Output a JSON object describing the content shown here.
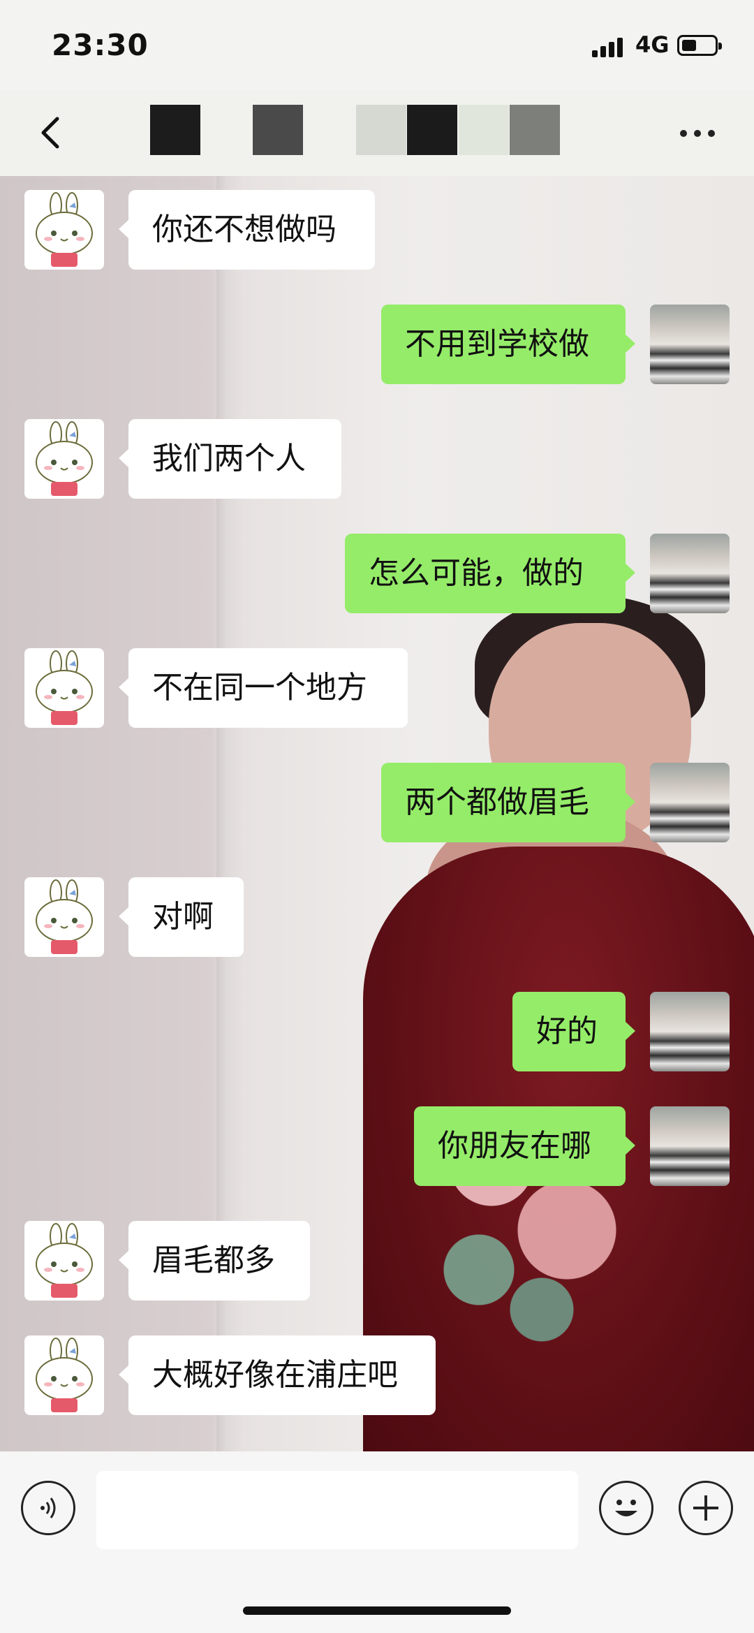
{
  "status_bar": {
    "time": "23:30",
    "network": "4G",
    "icons": [
      "signal-icon",
      "battery-icon"
    ]
  },
  "nav": {
    "back_icon": "chevron-left-icon",
    "more_icon": "more-icon"
  },
  "colors": {
    "outgoing_bubble": "#95ec69",
    "incoming_bubble": "#ffffff"
  },
  "messages": [
    {
      "side": "in",
      "text": "你还不想做吗"
    },
    {
      "side": "out",
      "text": "不用到学校做"
    },
    {
      "side": "in",
      "text": "我们两个人"
    },
    {
      "side": "out",
      "text": "怎么可能，做的"
    },
    {
      "side": "in",
      "text": "不在同一个地方"
    },
    {
      "side": "out",
      "text": "两个都做眉毛"
    },
    {
      "side": "in",
      "text": "对啊"
    },
    {
      "side": "out",
      "text": "好的"
    },
    {
      "side": "out",
      "text": "你朋友在哪"
    },
    {
      "side": "in",
      "text": "眉毛都多"
    },
    {
      "side": "in",
      "text": "大概好像在浦庄吧"
    }
  ],
  "input_bar": {
    "voice_icon": "voice-icon",
    "emoji_icon": "emoji-icon",
    "plus_icon": "plus-icon",
    "text": ""
  }
}
